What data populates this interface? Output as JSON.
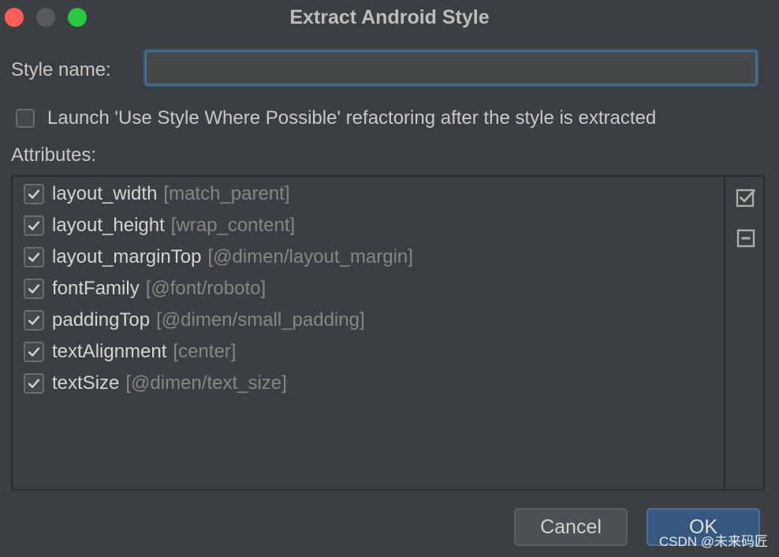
{
  "window": {
    "title": "Extract Android Style"
  },
  "form": {
    "style_name_label": "Style name:",
    "style_name_value": "",
    "launch_checkbox_label": "Launch 'Use Style Where Possible' refactoring after the style is extracted",
    "launch_checked": false,
    "attributes_label": "Attributes:"
  },
  "attributes": [
    {
      "name": "layout_width",
      "value": "[match_parent]",
      "checked": true
    },
    {
      "name": "layout_height",
      "value": "[wrap_content]",
      "checked": true
    },
    {
      "name": "layout_marginTop",
      "value": "[@dimen/layout_margin]",
      "checked": true
    },
    {
      "name": "fontFamily",
      "value": "[@font/roboto]",
      "checked": true
    },
    {
      "name": "paddingTop",
      "value": "[@dimen/small_padding]",
      "checked": true
    },
    {
      "name": "textAlignment",
      "value": "[center]",
      "checked": true
    },
    {
      "name": "textSize",
      "value": "[@dimen/text_size]",
      "checked": true
    }
  ],
  "tools": {
    "select_all_icon": "check-all-icon",
    "unselect_all_icon": "uncheck-all-icon"
  },
  "buttons": {
    "cancel_label": "Cancel",
    "ok_label": "OK"
  },
  "watermark": "CSDN @未来码匠",
  "colors": {
    "background": "#3c3f41",
    "accent_focus": "#466d94",
    "primary_button": "#365880"
  }
}
